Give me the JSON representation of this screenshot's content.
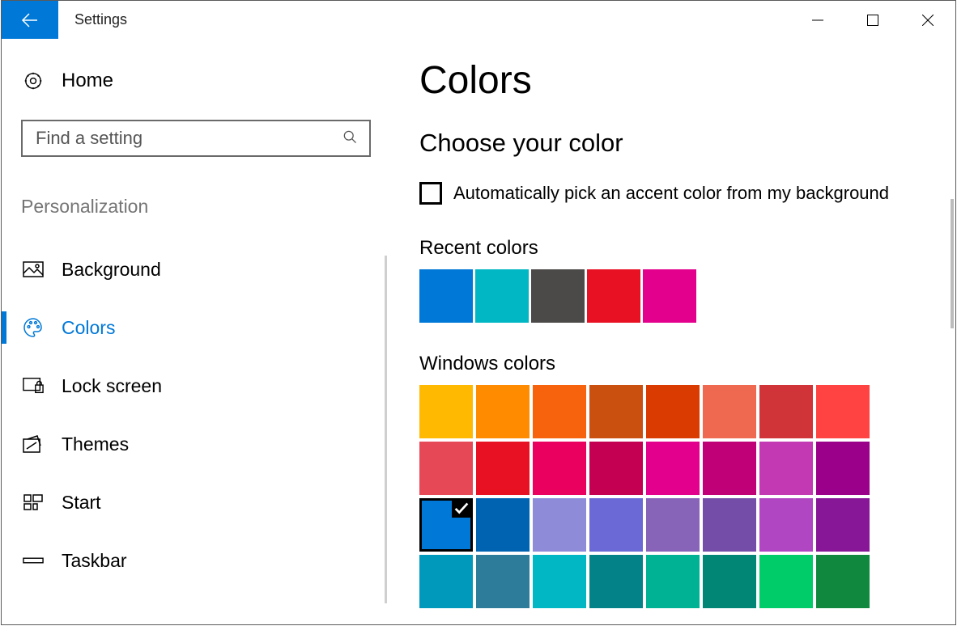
{
  "window": {
    "title": "Settings"
  },
  "sidebar": {
    "home": "Home",
    "search_placeholder": "Find a setting",
    "section": "Personalization",
    "items": [
      {
        "icon": "picture-icon",
        "label": "Background"
      },
      {
        "icon": "palette-icon",
        "label": "Colors",
        "active": true
      },
      {
        "icon": "lock-screen-icon",
        "label": "Lock screen"
      },
      {
        "icon": "themes-icon",
        "label": "Themes"
      },
      {
        "icon": "start-icon",
        "label": "Start"
      },
      {
        "icon": "taskbar-icon",
        "label": "Taskbar"
      }
    ]
  },
  "content": {
    "title": "Colors",
    "subheading": "Choose your color",
    "checkbox_label": "Automatically pick an accent color from my background",
    "checkbox_checked": false,
    "recent_heading": "Recent colors",
    "recent_colors": [
      "#0078d7",
      "#00b7c3",
      "#4c4a48",
      "#e81123",
      "#e3008c"
    ],
    "windows_heading": "Windows colors",
    "windows_colors": [
      "#ffb900",
      "#ff8c00",
      "#f7630c",
      "#ca5010",
      "#da3b01",
      "#ef6950",
      "#d13438",
      "#ff4343",
      "#e74856",
      "#e81123",
      "#ea005e",
      "#c30052",
      "#e3008c",
      "#bf0077",
      "#c239b3",
      "#9a0089",
      "#0078d7",
      "#0063b1",
      "#8e8cd8",
      "#6b69d6",
      "#8764b8",
      "#744da9",
      "#b146c2",
      "#881798",
      "#0099bc",
      "#2d7d9a",
      "#00b7c3",
      "#038387",
      "#00b294",
      "#018574",
      "#00cc6a",
      "#10893e"
    ],
    "selected_windows_index": 16
  }
}
